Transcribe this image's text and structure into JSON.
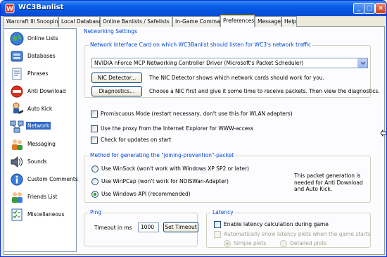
{
  "window": {
    "title": "WC3Banlist"
  },
  "tabs": [
    {
      "label": "Warcraft III Snooping"
    },
    {
      "label": "Local Database"
    },
    {
      "label": "Online Banlists / Safelists"
    },
    {
      "label": "In-Game Commands"
    },
    {
      "label": "Preferences"
    },
    {
      "label": "Messages"
    },
    {
      "label": "Help"
    }
  ],
  "sidebar": {
    "items": [
      {
        "label": "Online Lists",
        "icon": "globe-icon"
      },
      {
        "label": "Databases",
        "icon": "database-icon"
      },
      {
        "label": "Phrases",
        "icon": "document-icon"
      },
      {
        "label": "Anti Download",
        "icon": "no-entry-icon"
      },
      {
        "label": "Auto Kick",
        "icon": "kick-icon"
      },
      {
        "label": "Network",
        "icon": "network-icon"
      },
      {
        "label": "Messaging",
        "icon": "people-icon"
      },
      {
        "label": "Sounds",
        "icon": "speaker-icon"
      },
      {
        "label": "Custom Comments",
        "icon": "info-icon"
      },
      {
        "label": "Friends List",
        "icon": "friends-icon"
      },
      {
        "label": "Miscellaneous",
        "icon": "checklist-icon"
      }
    ]
  },
  "main": {
    "section_title": "Networking Settings",
    "nic_group": {
      "title": "Network Interface Card on which WC3Banlist should listen for WC3's network traffic",
      "selected_nic": "NVIDIA nForce MCP Networking Controller Driver (Microsoft's Packet Scheduler)",
      "nic_detector_button": "NIC Detector...",
      "nic_detector_text": "The NIC Detector shows which network cards should work for you.",
      "diagnostics_button": "Diagnostics...",
      "diagnostics_text": "Choose a NIC first and give it some time to receive packets. Then view the diagnostics."
    },
    "promiscuous_label": "Promiscuous Mode (restart necessary, don't use this for WLAN adapters)",
    "proxy_label": "Use the proxy from the Internet Explorer for WWW-access",
    "updates_label": "Check for updates on start",
    "method_group": {
      "title": "Method for generating the \"joining-prevention\"-packet",
      "options": [
        {
          "label": "Use WinSock (won't work with Windows XP SP2 or later)",
          "checked": false
        },
        {
          "label": "Use WinPCap (won't work for NDISWan-Adapter)",
          "checked": false
        },
        {
          "label": "Use Windows API (recommended)",
          "checked": true
        }
      ],
      "note": "This packet generation is needed for Anti Download and Auto Kick."
    },
    "ping_group": {
      "title": "Ping",
      "timeout_label": "Timeout in ms",
      "timeout_value": "1000",
      "set_timeout_button": "Set Timeout"
    },
    "latency_group": {
      "title": "Latency",
      "enable_label": "Enable latency calculation during game",
      "auto_show_label": "Automatically show latency plots when the game starts",
      "simple_label": "Simple plots",
      "detailed_label": "Detailed plots"
    }
  },
  "colors": {
    "titlebar": "#0453dd",
    "section_title": "#0046d5",
    "selection": "#316ac5"
  }
}
